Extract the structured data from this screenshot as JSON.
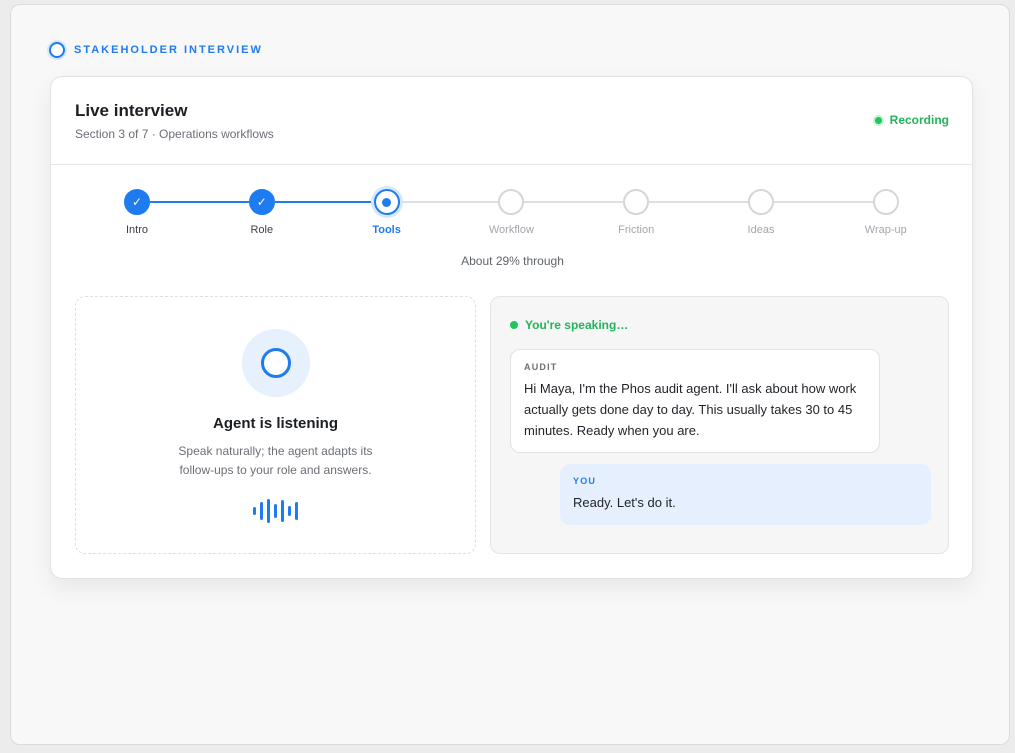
{
  "eyebrow": {
    "text": "STAKEHOLDER INTERVIEW",
    "icon": "ring-icon"
  },
  "header": {
    "title": "Live interview",
    "subtitle": "Section 3 of 7 · Operations workflows",
    "status": "Recording",
    "status_color": "#22c55e"
  },
  "stepper": {
    "steps": [
      {
        "label": "Intro",
        "state": "done"
      },
      {
        "label": "Role",
        "state": "done"
      },
      {
        "label": "Tools",
        "state": "current"
      },
      {
        "label": "Workflow",
        "state": "pending"
      },
      {
        "label": "Friction",
        "state": "pending"
      },
      {
        "label": "Ideas",
        "state": "pending"
      },
      {
        "label": "Wrap-up",
        "state": "pending"
      }
    ],
    "check_glyph": "✓",
    "progress_text": "About 29% through",
    "progress": 0.29
  },
  "agent_panel": {
    "title": "Agent is listening",
    "description": "Speak naturally; the agent adapts its follow-ups to your role and answers.",
    "icon": "microphone-ring-icon",
    "wave_icon": "audio-wave-icon"
  },
  "chat": {
    "speaking_status": "You're speaking…",
    "messages": [
      {
        "sender": "AUDIT",
        "text": "Hi Maya, I'm the Phos audit agent. I'll ask about how work actually gets done day to day. This usually takes 30 to 45 minutes. Ready when you are."
      },
      {
        "sender": "YOU",
        "text": "Ready. Let's do it."
      }
    ]
  },
  "colors": {
    "accent": "#1e7bf0",
    "success": "#22c55e",
    "user_bubble": "#e6effd"
  }
}
